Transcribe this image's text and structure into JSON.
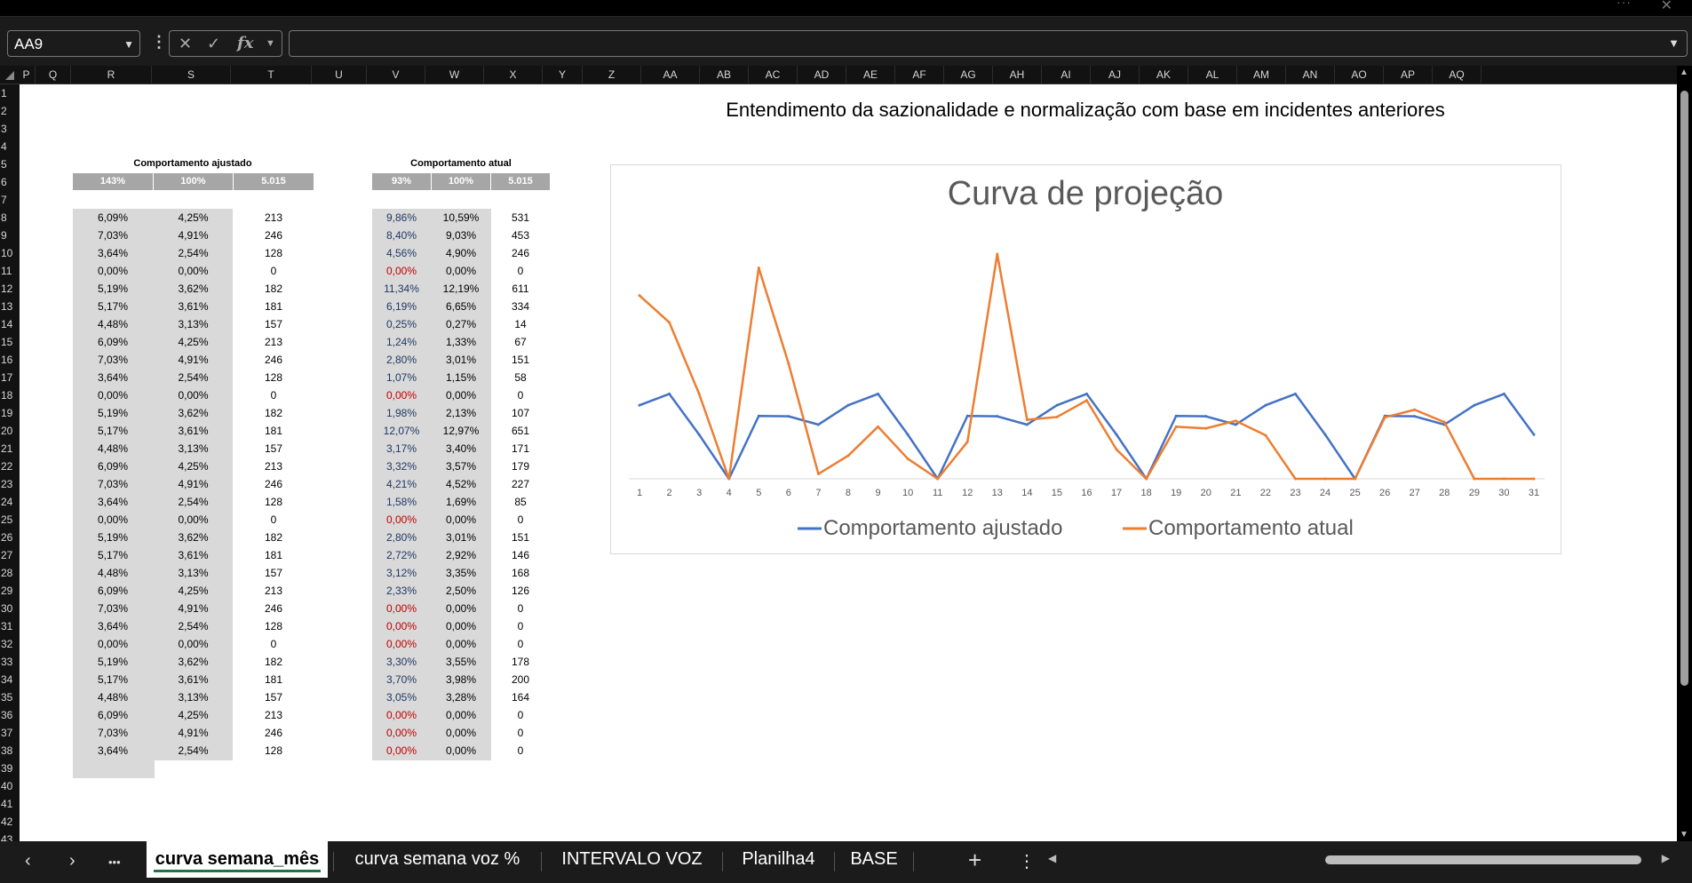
{
  "window": {
    "more_label": "···",
    "close_label": "✕"
  },
  "formula_bar": {
    "name_box": "AA9",
    "cancel_icon": "✕",
    "enter_icon": "✓",
    "fx_label": "fx",
    "formula": ""
  },
  "columns": [
    "P",
    "Q",
    "R",
    "S",
    "T",
    "U",
    "V",
    "W",
    "X",
    "Y",
    "Z",
    "AA",
    "AB",
    "AC",
    "AD",
    "AE",
    "AF",
    "AG",
    "AH",
    "AI",
    "AJ",
    "AK",
    "AL",
    "AM",
    "AN",
    "AO",
    "AP",
    "AQ"
  ],
  "rows": [
    "1",
    "2",
    "3",
    "4",
    "5",
    "6",
    "7",
    "8",
    "9",
    "10",
    "11",
    "12",
    "13",
    "14",
    "15",
    "16",
    "17",
    "18",
    "19",
    "20",
    "21",
    "22",
    "23",
    "24",
    "25",
    "26",
    "27",
    "28",
    "29",
    "30",
    "31",
    "32",
    "33",
    "34",
    "35",
    "36",
    "37",
    "38",
    "39",
    "40",
    "41",
    "42",
    "43"
  ],
  "sheet_title": "Entendimento da sazionalidade e normalização com base em incidentes anteriores",
  "left_table": {
    "title": "Comportamento ajustado",
    "header": [
      "143%",
      "100%",
      "5.015"
    ],
    "col_r": [
      "6,09%",
      "7,03%",
      "3,64%",
      "0,00%",
      "5,19%",
      "5,17%",
      "4,48%",
      "6,09%",
      "7,03%",
      "3,64%",
      "0,00%",
      "5,19%",
      "5,17%",
      "4,48%",
      "6,09%",
      "7,03%",
      "3,64%",
      "0,00%",
      "5,19%",
      "5,17%",
      "4,48%",
      "6,09%",
      "7,03%",
      "3,64%",
      "0,00%",
      "5,19%",
      "5,17%",
      "4,48%",
      "6,09%",
      "7,03%",
      "3,64%"
    ],
    "col_s": [
      "4,25%",
      "4,91%",
      "2,54%",
      "0,00%",
      "3,62%",
      "3,61%",
      "3,13%",
      "4,25%",
      "4,91%",
      "2,54%",
      "0,00%",
      "3,62%",
      "3,61%",
      "3,13%",
      "4,25%",
      "4,91%",
      "2,54%",
      "0,00%",
      "3,62%",
      "3,61%",
      "3,13%",
      "4,25%",
      "4,91%",
      "2,54%",
      "0,00%",
      "3,62%",
      "3,61%",
      "3,13%",
      "4,25%",
      "4,91%",
      "2,54%"
    ],
    "col_t": [
      "213",
      "246",
      "128",
      "0",
      "182",
      "181",
      "157",
      "213",
      "246",
      "128",
      "0",
      "182",
      "181",
      "157",
      "213",
      "246",
      "128",
      "0",
      "182",
      "181",
      "157",
      "213",
      "246",
      "128",
      "0",
      "182",
      "181",
      "157",
      "213",
      "246",
      "128"
    ]
  },
  "right_table": {
    "title": "Comportamento atual",
    "header": [
      "93%",
      "100%",
      "5.015"
    ],
    "col_v": [
      "9,86%",
      "8,40%",
      "4,56%",
      "0,00%",
      "11,34%",
      "6,19%",
      "0,25%",
      "1,24%",
      "2,80%",
      "1,07%",
      "0,00%",
      "1,98%",
      "12,07%",
      "3,17%",
      "3,32%",
      "4,21%",
      "1,58%",
      "0,00%",
      "2,80%",
      "2,72%",
      "3,12%",
      "2,33%",
      "0,00%",
      "0,00%",
      "0,00%",
      "3,30%",
      "3,70%",
      "3,05%",
      "0,00%",
      "0,00%",
      "0,00%"
    ],
    "col_w": [
      "10,59%",
      "9,03%",
      "4,90%",
      "0,00%",
      "12,19%",
      "6,65%",
      "0,27%",
      "1,33%",
      "3,01%",
      "1,15%",
      "0,00%",
      "2,13%",
      "12,97%",
      "3,40%",
      "3,57%",
      "4,52%",
      "1,69%",
      "0,00%",
      "3,01%",
      "2,92%",
      "3,35%",
      "2,50%",
      "0,00%",
      "0,00%",
      "0,00%",
      "3,55%",
      "3,98%",
      "3,28%",
      "0,00%",
      "0,00%",
      "0,00%"
    ],
    "col_x": [
      "531",
      "453",
      "246",
      "0",
      "611",
      "334",
      "14",
      "67",
      "151",
      "58",
      "0",
      "107",
      "651",
      "171",
      "179",
      "227",
      "85",
      "0",
      "151",
      "146",
      "168",
      "126",
      "0",
      "0",
      "0",
      "178",
      "200",
      "164",
      "0",
      "0",
      "0"
    ]
  },
  "colors": {
    "positive": "#1f3864",
    "zero": "#c00000",
    "series1": "#4472c4",
    "series2": "#ed7d31"
  },
  "chart_data": {
    "type": "line",
    "title": "Curva de projeção",
    "x": [
      "1",
      "2",
      "3",
      "4",
      "5",
      "6",
      "7",
      "8",
      "9",
      "10",
      "11",
      "12",
      "13",
      "14",
      "15",
      "16",
      "17",
      "18",
      "19",
      "20",
      "21",
      "22",
      "23",
      "24",
      "25",
      "26",
      "27",
      "28",
      "29",
      "30",
      "31"
    ],
    "series": [
      {
        "name": "Comportamento ajustado",
        "values": [
          213,
          246,
          128,
          0,
          182,
          181,
          157,
          213,
          246,
          128,
          0,
          182,
          181,
          157,
          213,
          246,
          128,
          0,
          182,
          181,
          157,
          213,
          246,
          128,
          0,
          182,
          181,
          157,
          213,
          246,
          128
        ]
      },
      {
        "name": "Comportamento atual",
        "values": [
          531,
          453,
          246,
          0,
          611,
          334,
          14,
          67,
          151,
          58,
          0,
          107,
          651,
          171,
          179,
          227,
          85,
          0,
          151,
          146,
          168,
          126,
          0,
          0,
          0,
          178,
          200,
          164,
          0,
          0,
          0
        ]
      }
    ],
    "ylim": [
      0,
      651
    ],
    "grid": false,
    "legend": "bottom"
  },
  "tabs": {
    "prev": "‹",
    "next": "›",
    "more": "•••",
    "items": [
      "curva semana_mês",
      "curva semana voz %",
      "INTERVALO VOZ",
      "Planilha4",
      "BASE"
    ],
    "active": 0,
    "add": "+",
    "options": "⋮"
  }
}
